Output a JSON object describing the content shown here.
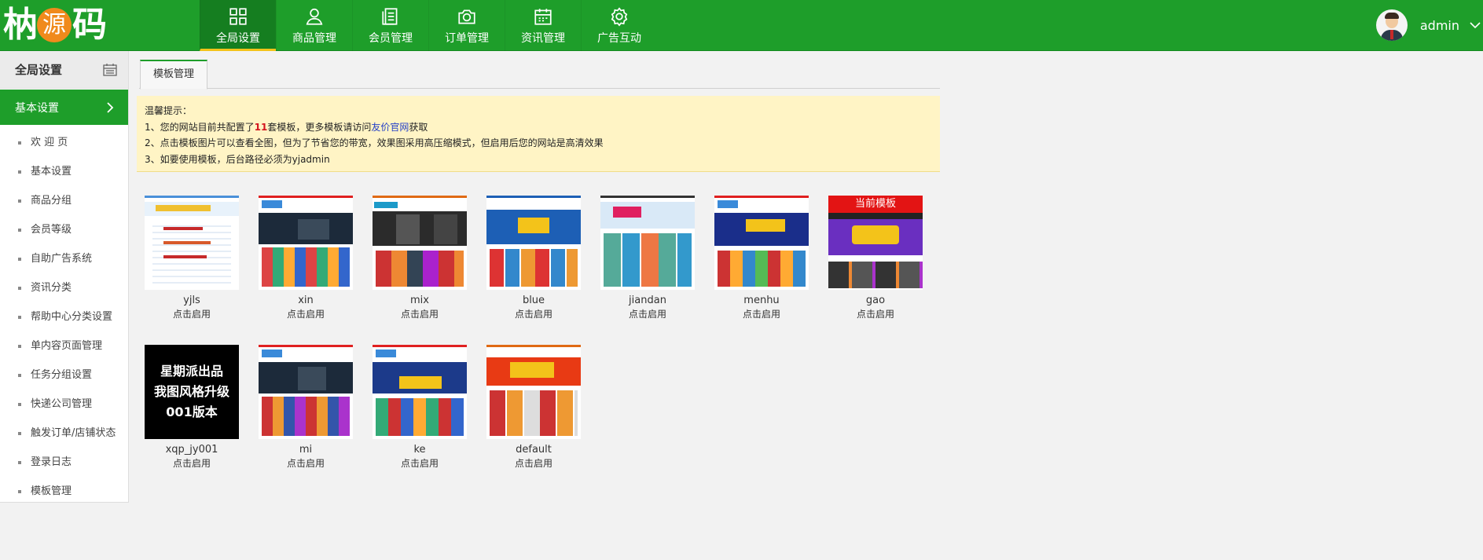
{
  "header": {
    "logo_text_left": "枘",
    "logo_text_badge": "源",
    "logo_text_right": "码",
    "nav": [
      {
        "label": "全局设置",
        "icon": "grid-icon",
        "active": true
      },
      {
        "label": "商品管理",
        "icon": "user-icon",
        "active": false
      },
      {
        "label": "会员管理",
        "icon": "document-icon",
        "active": false
      },
      {
        "label": "订单管理",
        "icon": "camera-icon",
        "active": false
      },
      {
        "label": "资讯管理",
        "icon": "calendar-icon",
        "active": false
      },
      {
        "label": "广告互动",
        "icon": "gear-icon",
        "active": false
      }
    ],
    "user": {
      "name": "admin"
    }
  },
  "sidebar": {
    "title": "全局设置",
    "section": "基本设置",
    "items": [
      {
        "label": "欢 迎 页"
      },
      {
        "label": "基本设置"
      },
      {
        "label": "商品分组"
      },
      {
        "label": "会员等级"
      },
      {
        "label": "自助广告系统"
      },
      {
        "label": "资讯分类"
      },
      {
        "label": "帮助中心分类设置"
      },
      {
        "label": "单内容页面管理"
      },
      {
        "label": "任务分组设置"
      },
      {
        "label": "快递公司管理"
      },
      {
        "label": "触发订单/店铺状态"
      },
      {
        "label": "登录日志"
      },
      {
        "label": "模板管理"
      }
    ]
  },
  "tabs": [
    {
      "label": "模板管理"
    }
  ],
  "notice": {
    "title": "温馨提示：",
    "line1_a": "1、您的网站目前共配置了",
    "line1_num": "11",
    "line1_b": "套模板，更多模板请访问",
    "line1_link": "友价官网",
    "line1_c": "获取",
    "line2": "2、点击模板图片可以查看全图，但为了节省您的带宽，效果图采用高压缩模式，但启用后您的网站是高清效果",
    "line3": "3、如要使用模板，后台路径必须为yjadmin"
  },
  "templates": [
    {
      "name": "yjls",
      "action": "点击启用",
      "theme": "#e8f2fb"
    },
    {
      "name": "xin",
      "action": "点击启用",
      "theme": "#1c2a3a"
    },
    {
      "name": "mix",
      "action": "点击启用",
      "theme": "#2b2b2b"
    },
    {
      "name": "blue",
      "action": "点击启用",
      "theme": "#1d5fb5"
    },
    {
      "name": "jiandan",
      "action": "点击启用",
      "theme": "#d9e9f7"
    },
    {
      "name": "menhu",
      "action": "点击启用",
      "theme": "#1a2e8a"
    },
    {
      "name": "gao",
      "action": "点击启用",
      "theme": "#6a2fc0",
      "current_label": "当前模板"
    },
    {
      "name": "xqp_jy001",
      "action": "点击启用",
      "black_lines": [
        "星期派出品",
        "我图风格升级",
        "001版本"
      ]
    },
    {
      "name": "mi",
      "action": "点击启用",
      "theme": "#1c2a3a"
    },
    {
      "name": "ke",
      "action": "点击启用",
      "theme": "#1c3a8a"
    },
    {
      "name": "default",
      "action": "点击启用",
      "theme": "#e83a14"
    }
  ],
  "colors": {
    "brand_green": "#1e9e2a",
    "active_underline": "#f3c31a",
    "notice_bg": "#fff4c5",
    "current_badge": "#e31414"
  }
}
